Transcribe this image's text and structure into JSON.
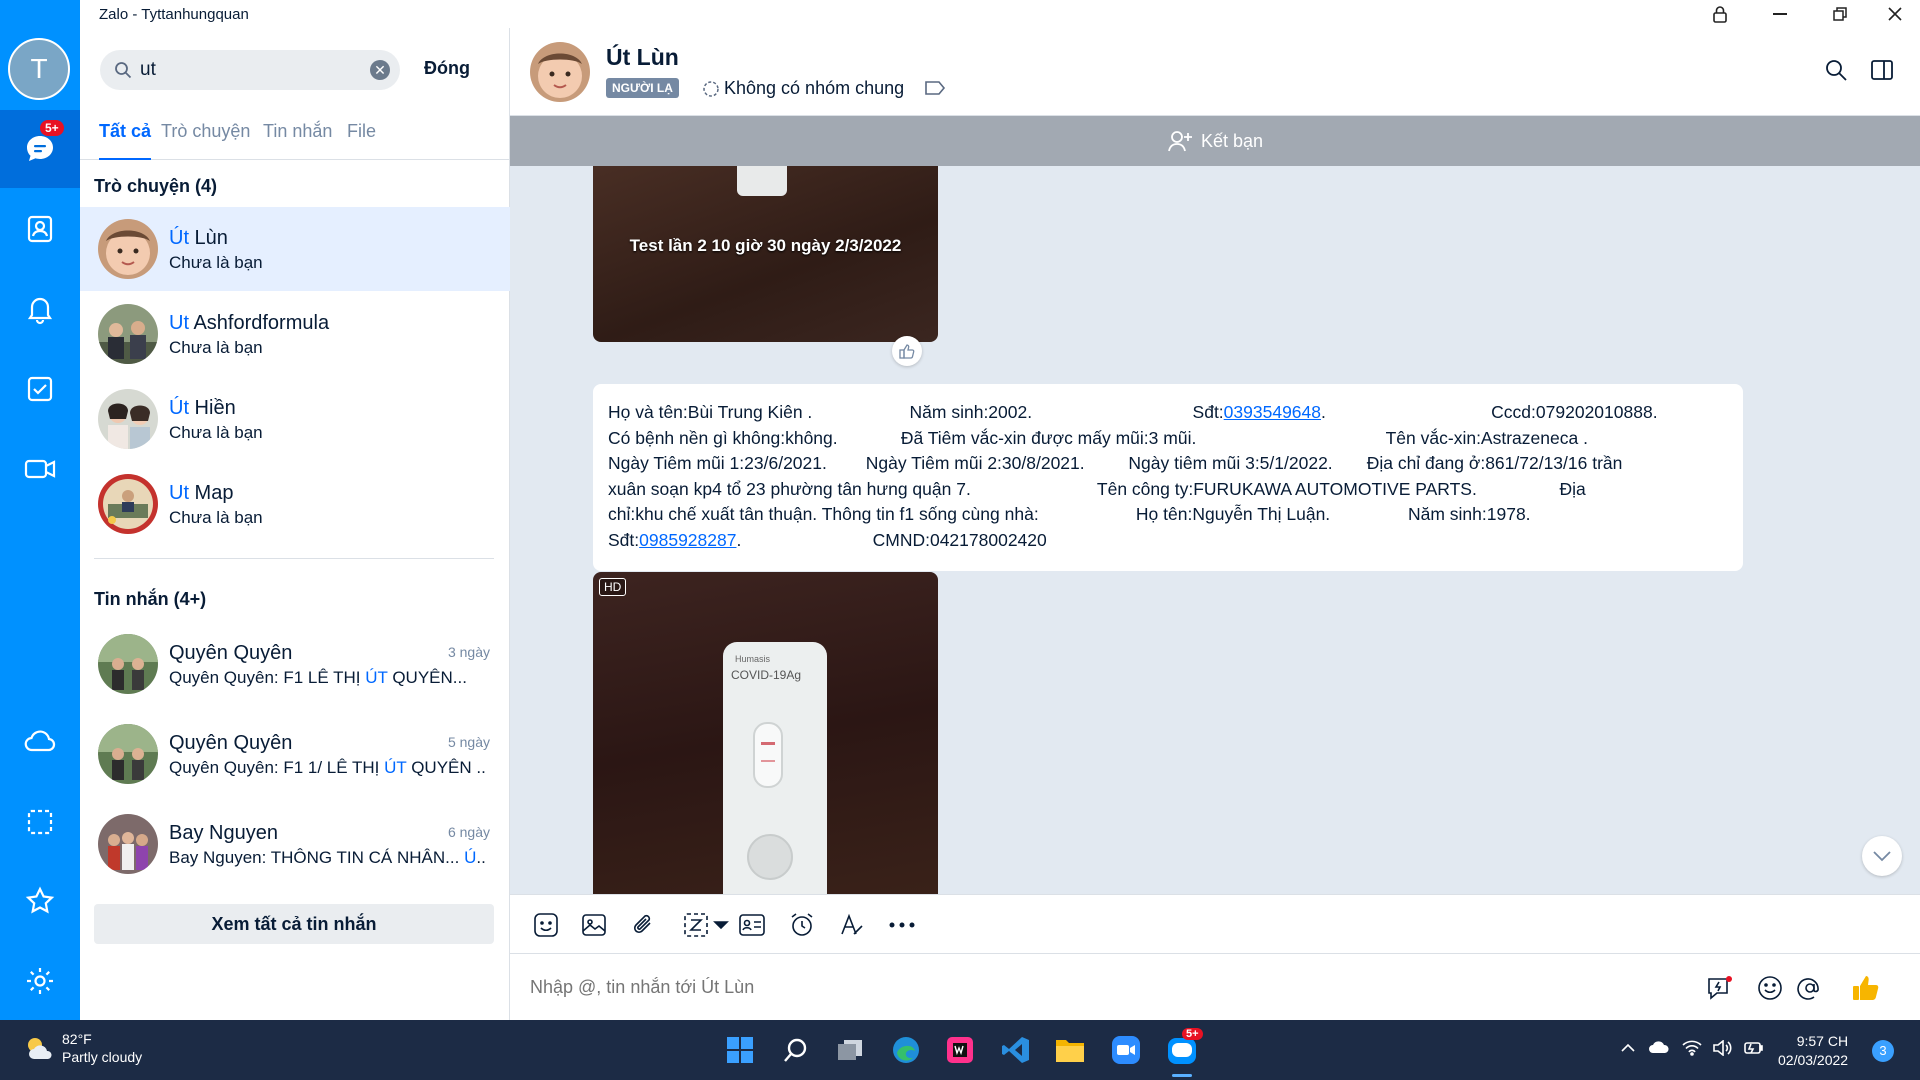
{
  "window": {
    "title": "Zalo - Tyttanhungquan"
  },
  "rail": {
    "avatar_letter": "T",
    "message_badge": "5+"
  },
  "search": {
    "value": "ut",
    "close_label": "Đóng"
  },
  "tabs": [
    "Tất cả",
    "Trò chuyện",
    "Tin nhắn",
    "File"
  ],
  "sections": {
    "conversations": "Trò chuyện (4)",
    "messages": "Tin nhắn (4+)"
  },
  "conversations": [
    {
      "name_hl": "Út",
      "name_rest": " Lùn",
      "sub": "Chưa là bạn"
    },
    {
      "name_hl": "Ut",
      "name_rest": " Ashfordformula",
      "sub": "Chưa là bạn"
    },
    {
      "name_hl": "Út",
      "name_rest": " Hiền",
      "sub": "Chưa là bạn"
    },
    {
      "name_hl": "Ut",
      "name_rest": " Map",
      "sub": "Chưa là bạn"
    }
  ],
  "messages": [
    {
      "name": "Quyên Quyên",
      "time": "3 ngày",
      "pre": "Quyên Quyên: F1 LÊ THỊ ",
      "hl": "ÚT",
      "post": " QUYÊN..."
    },
    {
      "name": "Quyên Quyên",
      "time": "5 ngày",
      "pre": "Quyên Quyên: F1 1/ LÊ THỊ ",
      "hl": "ÚT",
      "post": " QUYÊN ..."
    },
    {
      "name": "Bay Nguyen",
      "time": "6 ngày",
      "pre": "Bay Nguyen: THÔNG TIN CÁ NHÂN... ",
      "hl": "Ú",
      "post": "..."
    }
  ],
  "view_all_label": "Xem tất cả tin nhắn",
  "chat": {
    "name": "Út Lùn",
    "stranger_tag": "NGƯỜI LẠ",
    "groups_text": "Không có nhóm chung",
    "add_friend_label": "Kết bạn",
    "image1_caption": "Test lần 2 10 giờ 30 ngày 2/3/2022",
    "image2_tag": "HD",
    "kit_brand": "Humasis",
    "kit_label": "COVID-19Ag",
    "text_lines": {
      "l1a": "Họ và tên:Bùi Trung Kiên .                    Năm sinh:2002.                                 Sđt:",
      "l1_phone": "0393549648",
      "l1b": ".                                  Cccd:079202010888.",
      "l2": "Có bệnh nền gì không:không.             Đã Tiêm vắc-xin được mấy mũi:3 mũi.                                       Tên vắc-xin:Astrazeneca .",
      "l3": "Ngày Tiêm mũi 1:23/6/2021.        Ngày Tiêm mũi 2:30/8/2021.         Ngày tiêm mũi 3:5/1/2022.       Địa chỉ đang ở:861/72/13/16 trần",
      "l4": "xuân soạn kp4 tổ 23 phường tân hưng quận 7.                          Tên công ty:FURUKAWA AUTOMOTIVE PARTS.                 Địa",
      "l5": "chỉ:khu chế xuất tân thuận. Thông tin f1 sống cùng nhà:                    Họ tên:Nguyễn Thị Luận.                Năm sinh:1978.",
      "l6a": "Sđt:",
      "l6_phone": "0985928287",
      "l6b": ".                           CMND:042178002420"
    }
  },
  "composer": {
    "placeholder": "Nhập @, tin nhắn tới Út Lùn"
  },
  "taskbar": {
    "temp": "82°F",
    "weather": "Partly cloudy",
    "time": "9:57 CH",
    "date": "02/03/2022",
    "zalo_badge": "5+",
    "notif_count": "3"
  },
  "colors": {
    "rail": "#0091ff",
    "rail_active": "#006edc",
    "accent": "#0068ff",
    "taskbar": "#1c2b45"
  }
}
